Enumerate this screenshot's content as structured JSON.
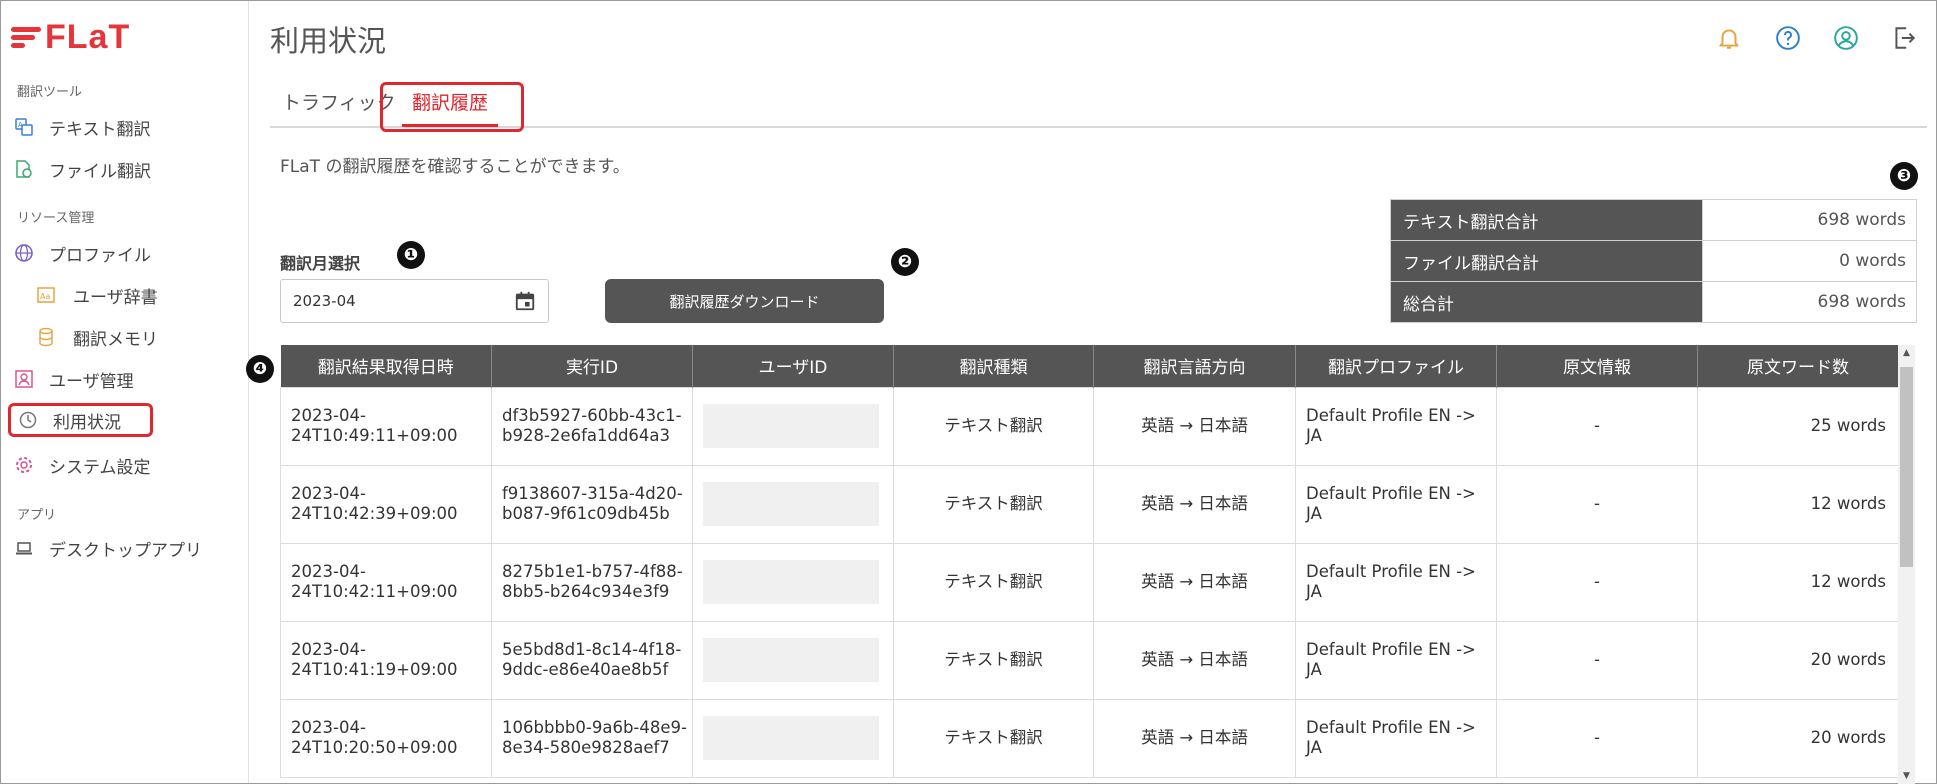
{
  "brand": {
    "logo_text": "FLaT"
  },
  "sidebar": {
    "sections": [
      {
        "label": "翻訳ツール"
      },
      {
        "label": "リソース管理"
      },
      {
        "label": "アプリ"
      }
    ],
    "items": [
      {
        "label": "テキスト翻訳",
        "icon": "text-translate-icon"
      },
      {
        "label": "ファイル翻訳",
        "icon": "file-translate-icon"
      },
      {
        "label": "プロファイル",
        "icon": "globe-icon"
      },
      {
        "label": "ユーザ辞書",
        "icon": "dictionary-icon"
      },
      {
        "label": "翻訳メモリ",
        "icon": "database-icon"
      },
      {
        "label": "ユーザ管理",
        "icon": "user-management-icon"
      },
      {
        "label": "利用状況",
        "icon": "history-icon"
      },
      {
        "label": "システム設定",
        "icon": "gear-icon"
      },
      {
        "label": "デスクトップアプリ",
        "icon": "laptop-icon"
      }
    ]
  },
  "header": {
    "title": "利用状況",
    "icons": [
      "bell-icon",
      "help-icon",
      "account-icon",
      "logout-icon"
    ],
    "colors": {
      "bell": "#e8a33d",
      "help": "#2a7fc9",
      "account": "#2aa89a",
      "logout": "#555555"
    }
  },
  "tabs": [
    {
      "label": "トラフィック"
    },
    {
      "label": "翻訳履歴"
    }
  ],
  "description": "FLaT の翻訳履歴を確認することができます。",
  "month": {
    "label": "翻訳月選択",
    "value": "2023-04"
  },
  "download_button": "翻訳履歴ダウンロード",
  "badges": [
    "❶",
    "❷",
    "❸",
    "❹"
  ],
  "summary": [
    {
      "key": "テキスト翻訳合計",
      "value": "698 words"
    },
    {
      "key": "ファイル翻訳合計",
      "value": "0 words"
    },
    {
      "key": "総合計",
      "value": "698 words"
    }
  ],
  "history": {
    "columns": [
      "翻訳結果取得日時",
      "実行ID",
      "ユーザID",
      "翻訳種類",
      "翻訳言語方向",
      "翻訳プロファイル",
      "原文情報",
      "原文ワード数"
    ],
    "rows": [
      {
        "datetime": "2023-04-24T10:49:11+09:00",
        "exec_id": "df3b5927-60bb-43c1-b928-2e6fa1dd64a3",
        "type": "テキスト翻訳",
        "direction": "英語 → 日本語",
        "profile": "Default Profile EN -> JA",
        "source": "-",
        "words": "25 words"
      },
      {
        "datetime": "2023-04-24T10:42:39+09:00",
        "exec_id": "f9138607-315a-4d20-b087-9f61c09db45b",
        "type": "テキスト翻訳",
        "direction": "英語 → 日本語",
        "profile": "Default Profile EN -> JA",
        "source": "-",
        "words": "12 words"
      },
      {
        "datetime": "2023-04-24T10:42:11+09:00",
        "exec_id": "8275b1e1-b757-4f88-8bb5-b264c934e3f9",
        "type": "テキスト翻訳",
        "direction": "英語 → 日本語",
        "profile": "Default Profile EN -> JA",
        "source": "-",
        "words": "12 words"
      },
      {
        "datetime": "2023-04-24T10:41:19+09:00",
        "exec_id": "5e5bd8d1-8c14-4f18-9ddc-e86e40ae8b5f",
        "type": "テキスト翻訳",
        "direction": "英語 → 日本語",
        "profile": "Default Profile EN -> JA",
        "source": "-",
        "words": "20 words"
      },
      {
        "datetime": "2023-04-24T10:20:50+09:00",
        "exec_id": "106bbbb0-9a6b-48e9-8e34-580e9828aef7",
        "type": "テキスト翻訳",
        "direction": "英語 → 日本語",
        "profile": "Default Profile EN -> JA",
        "source": "-",
        "words": "20 words"
      }
    ]
  },
  "accent_color": "#e0262e"
}
